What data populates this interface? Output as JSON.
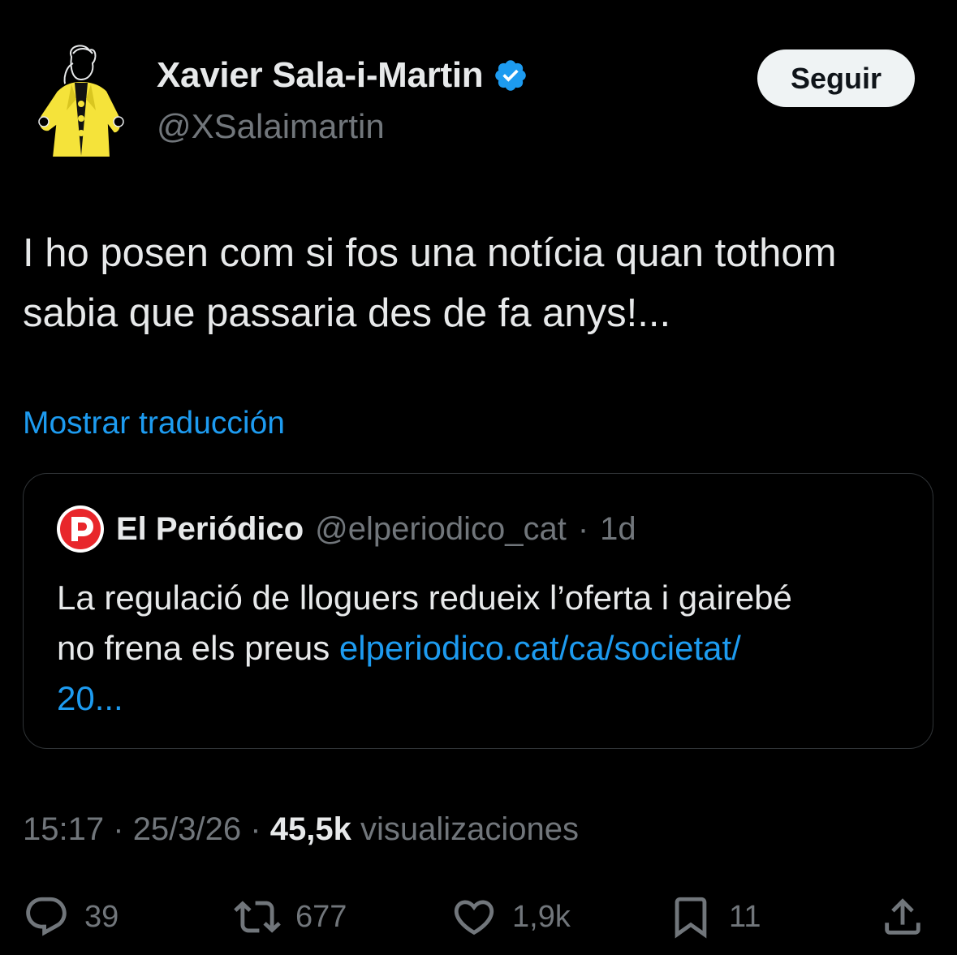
{
  "author": {
    "display_name": "Xavier Sala-i-Martin",
    "handle": "@XSalaimartin",
    "verified": true
  },
  "follow_button_label": "Seguir",
  "tweet": {
    "text_line1": "I ho posen com si fos una notícia quan tothom",
    "text_line2": "sabia que passaria des de fa anys!...",
    "translate_label": "Mostrar traducción"
  },
  "quote": {
    "name": "El Periódico",
    "handle": "@elperiodico_cat",
    "separator": "·",
    "age": "1d",
    "text_line1": "La regulació de lloguers redueix l’oferta i gairebé",
    "text_line2_prefix": "no frena els preus ",
    "link_part1": "elperiodico.cat/ca/societat/",
    "link_part2": "20..."
  },
  "meta": {
    "time": "15:17",
    "date": "25/3/26",
    "separator": "·",
    "views_count": "45,5k",
    "views_label": "visualizaciones"
  },
  "actions": {
    "replies": "39",
    "reposts": "677",
    "likes": "1,9k",
    "bookmarks": "11"
  },
  "colors": {
    "background": "#000000",
    "text": "#e7e9ea",
    "secondary": "#71767b",
    "link": "#1d9bf0",
    "border": "#2f3336",
    "avatar_jacket": "#f5e33a",
    "quote_logo": "#e8262b"
  },
  "icons": {
    "verified": "verified-badge-icon",
    "reply": "reply-icon",
    "repost": "repost-icon",
    "like": "heart-icon",
    "bookmark": "bookmark-icon",
    "share": "share-icon"
  }
}
